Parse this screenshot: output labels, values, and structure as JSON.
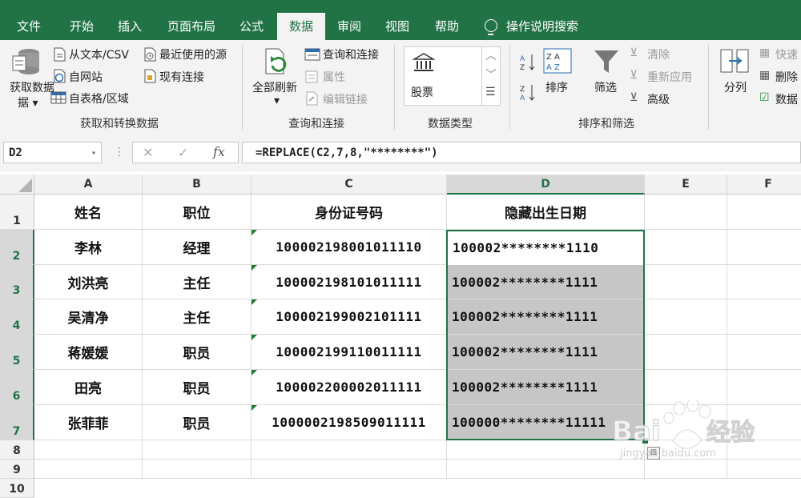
{
  "ribbon_tabs": [
    "文件",
    "开始",
    "插入",
    "页面布局",
    "公式",
    "数据",
    "审阅",
    "视图",
    "帮助"
  ],
  "active_tab": "数据",
  "tell_me": "操作说明搜索",
  "groups": {
    "get_transform": {
      "label": "获取和转换数据",
      "get_data": "获取数据",
      "from_text": "从文本/CSV",
      "from_web": "自网站",
      "from_table": "自表格/区域",
      "recent_sources": "最近使用的源",
      "existing_connections": "现有连接"
    },
    "queries": {
      "label": "查询和连接",
      "refresh_all": "全部刷新",
      "queries_connections": "查询和连接",
      "properties": "属性",
      "edit_links": "编辑链接"
    },
    "data_types": {
      "label": "数据类型",
      "stocks": "股票"
    },
    "sort_filter": {
      "label": "排序和筛选",
      "sort": "排序",
      "filter": "筛选",
      "clear": "清除",
      "reapply": "重新应用",
      "advanced": "高级"
    },
    "data_tools": {
      "text_to_columns": "分列",
      "flash_fill": "快速",
      "remove_duplicates": "删除",
      "validation": "数据"
    }
  },
  "formula_bar": {
    "name_box": "D2",
    "cancel": "✕",
    "enter": "✓",
    "fx": "fx",
    "formula": "=REPLACE(C2,7,8,\"********\")"
  },
  "columns": [
    "A",
    "B",
    "C",
    "D",
    "E",
    "F"
  ],
  "selected_column": "D",
  "row_numbers": [
    "1",
    "2",
    "3",
    "4",
    "5",
    "6",
    "7",
    "8",
    "9",
    "10"
  ],
  "table": {
    "headers": [
      "姓名",
      "职位",
      "身份证号码",
      "隐藏出生日期"
    ],
    "rows": [
      {
        "name": "李林",
        "title": "经理",
        "id": "100002198001011110",
        "masked": "100002********1110"
      },
      {
        "name": "刘洪亮",
        "title": "主任",
        "id": "100002198101011111",
        "masked": "100002********1111"
      },
      {
        "name": "吴清净",
        "title": "主任",
        "id": "100002199002101111",
        "masked": "100002********1111"
      },
      {
        "name": "蒋媛媛",
        "title": "职员",
        "id": "100002199110011111",
        "masked": "100002********1111"
      },
      {
        "name": "田亮",
        "title": "职员",
        "id": "100002200002011111",
        "masked": "100002********1111"
      },
      {
        "name": "张菲菲",
        "title": "职员",
        "id": "1000002198509011111",
        "masked": "100000********11111"
      }
    ]
  },
  "watermark": {
    "brand": "Bai du 经验",
    "url": "jingyan.baidu.com"
  },
  "colors": {
    "excel_green": "#217346",
    "selection_fill": "#c6c6c6",
    "ribbon_bg": "#f3f3f3"
  }
}
